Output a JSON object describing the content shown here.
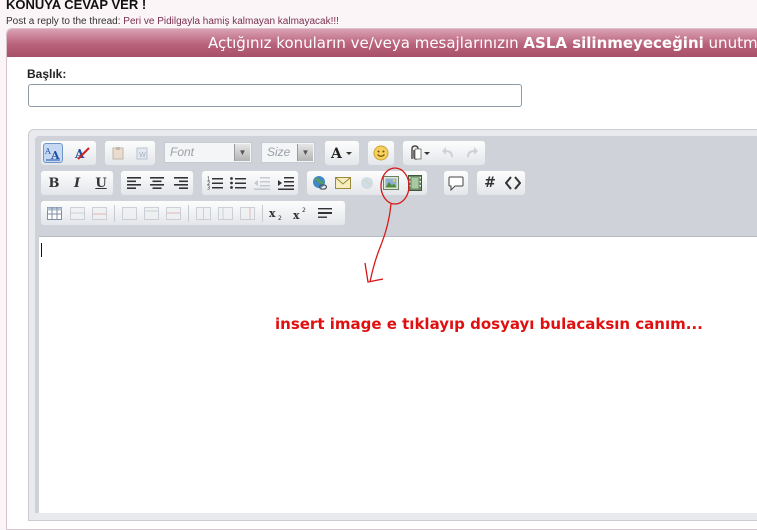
{
  "page": {
    "title": "KONUYA CEVAP VER !",
    "reply_prefix": "Post a reply to the thread:",
    "thread_title": "Peri ve Pidilgayla hamiş kalmayan kalmayacak!!!"
  },
  "banner": {
    "text_before": "Açtığınız konuların ve/veya mesajlarınızın ",
    "emphasis": "ASLA silinmeyeceğini",
    "text_after": " unutmayın"
  },
  "form": {
    "title_label": "Başlık:",
    "title_value": ""
  },
  "toolbar": {
    "font_placeholder": "Font",
    "size_placeholder": "Size",
    "dropdown_glyph": "▼",
    "rows": [
      [
        "switch-mode",
        "remove-format",
        "paste",
        "paste-from-word",
        "font",
        "size",
        "text-color",
        "smilies",
        "attach",
        "undo",
        "redo"
      ],
      [
        "bold",
        "italic",
        "underline",
        "align-left",
        "align-center",
        "align-right",
        "ordered-list",
        "unordered-list",
        "outdent",
        "indent",
        "insert-link",
        "insert-email",
        "unlink",
        "insert-image",
        "insert-video",
        "quote",
        "wrap-code",
        "wrap-html"
      ],
      [
        "table",
        "insert-row-above",
        "insert-row-below",
        "delete-row",
        "insert-col-left",
        "insert-col-right",
        "delete-col",
        "subscript",
        "superscript",
        "horizontal-rule"
      ]
    ]
  },
  "annotation": {
    "text": "insert image e tıklayıp dosyayı bulacaksın canım...",
    "color": "#e01010"
  },
  "colors": {
    "banner": "#b9627c",
    "editor_bg": "#cfd3d9",
    "selected_button": "#c7d9f2"
  }
}
